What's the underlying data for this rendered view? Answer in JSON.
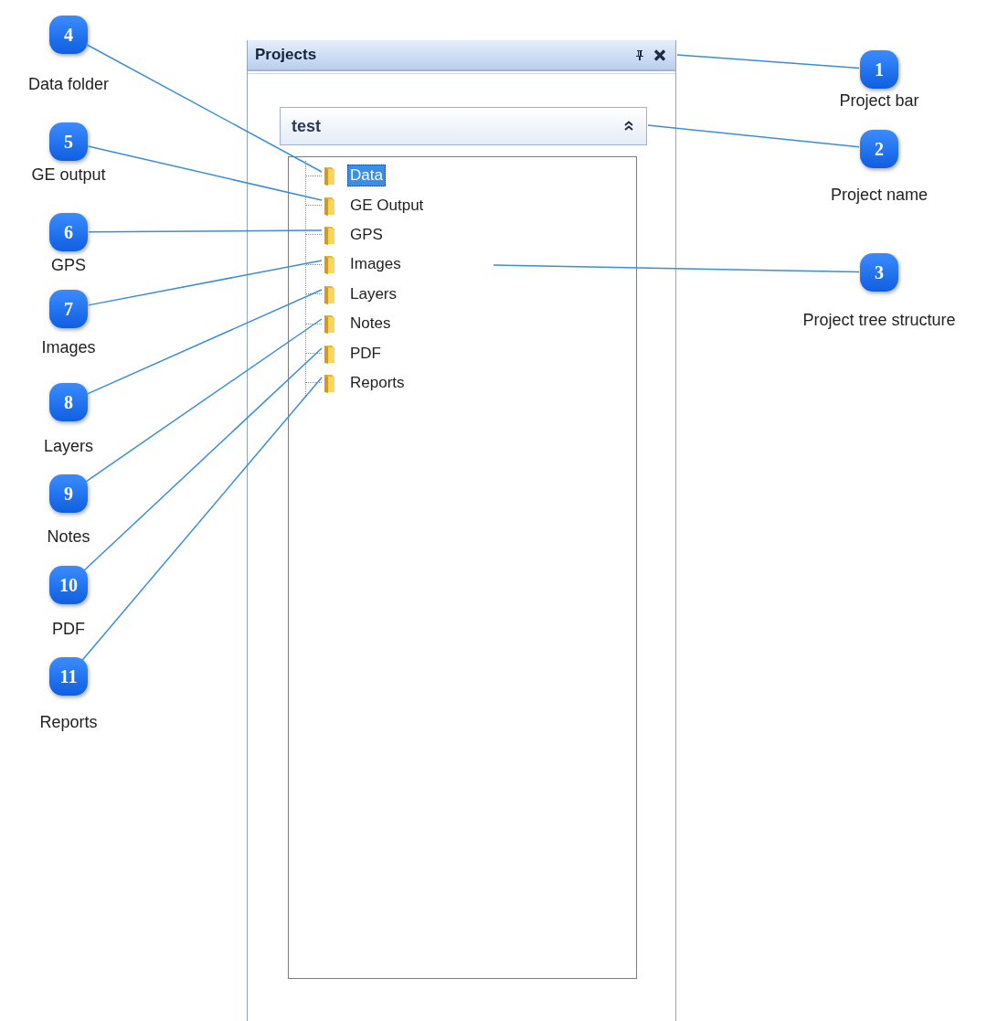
{
  "panel": {
    "title": "Projects",
    "project": {
      "name": "test",
      "expanded": true
    },
    "tree": {
      "items": [
        {
          "label": "Data",
          "selected": true
        },
        {
          "label": "GE Output",
          "selected": false
        },
        {
          "label": "GPS",
          "selected": false
        },
        {
          "label": "Images",
          "selected": false
        },
        {
          "label": "Layers",
          "selected": false
        },
        {
          "label": "Notes",
          "selected": false
        },
        {
          "label": "PDF",
          "selected": false
        },
        {
          "label": "Reports",
          "selected": false
        }
      ]
    }
  },
  "callouts": [
    {
      "number": "4",
      "label": "Data folder"
    },
    {
      "number": "5",
      "label": "GE output"
    },
    {
      "number": "6",
      "label": "GPS"
    },
    {
      "number": "7",
      "label": "Images"
    },
    {
      "number": "8",
      "label": "Layers"
    },
    {
      "number": "9",
      "label": "Notes"
    },
    {
      "number": "10",
      "label": "PDF"
    },
    {
      "number": "11",
      "label": "Reports"
    },
    {
      "number": "1",
      "label": "Project bar"
    },
    {
      "number": "2",
      "label": "Project name"
    },
    {
      "number": "3",
      "label": "Project tree structure"
    }
  ]
}
